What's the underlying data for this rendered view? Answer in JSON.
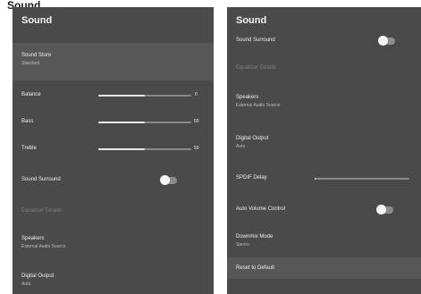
{
  "page_header": "Sound",
  "left": {
    "title": "Sound",
    "sound_store": {
      "label": "Sound Store",
      "value": "Standard"
    },
    "balance": {
      "label": "Balance",
      "value": "0",
      "fill": 0.5
    },
    "bass": {
      "label": "Bass",
      "value": "50",
      "fill": 0.5
    },
    "treble": {
      "label": "Treble",
      "value": "50",
      "fill": 0.5
    },
    "sound_surround": {
      "label": "Sound Surround",
      "state": "off"
    },
    "equalizer": {
      "label": "Equalizer Details"
    },
    "speakers": {
      "label": "Speakers",
      "value": "External Audio Source"
    },
    "digital_output": {
      "label": "Digital Output",
      "value": "Auto"
    }
  },
  "right": {
    "title": "Sound",
    "top_partial": {
      "label": "Sound Surround",
      "state": "off"
    },
    "equalizer": {
      "label": "Equalizer Details"
    },
    "speakers": {
      "label": "Speakers",
      "value": "External Audio Source"
    },
    "digital_output": {
      "label": "Digital Output",
      "value": "Auto"
    },
    "spdif_delay": {
      "label": "SPDIF Delay",
      "fill": 0.0
    },
    "auto_volume": {
      "label": "Auto Volume Control",
      "state": "off"
    },
    "downmix": {
      "label": "Downmix Mode",
      "value": "Stereo"
    },
    "reset": {
      "label": "Reset to Default"
    }
  }
}
